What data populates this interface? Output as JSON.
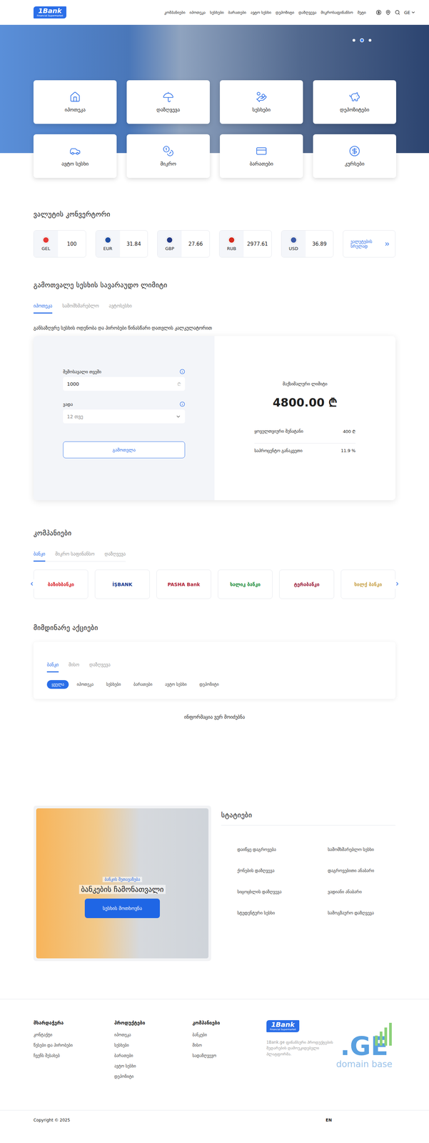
{
  "header": {
    "logo": {
      "title": "1Bank",
      "subtitle": "Financial Supermarket"
    },
    "nav": [
      "კომპანიები",
      "იპოთეკა",
      "სესხები",
      "ბარათები",
      "ავტო სესხი",
      "დეპოზიტი",
      "დაზღვევა",
      "მიკროსაფინანსო",
      "მეტი"
    ],
    "language": "GE"
  },
  "hero": {
    "slides": [
      {
        "selected": false
      },
      {
        "selected": true
      },
      {
        "selected": false
      }
    ]
  },
  "categories": [
    "იპოთეკა",
    "დაზღვევა",
    "სესხები",
    "დეპოზიტები",
    "ავტო სესხი",
    "მიკრო",
    "ბარათები",
    "კურსები"
  ],
  "converter": {
    "title": "ვალუტის კონვერტორი",
    "currencies": [
      {
        "code": "GEL",
        "amount": "100",
        "color": "#e53935"
      },
      {
        "code": "EUR",
        "amount": "31.84",
        "color": "#1f4ea3"
      },
      {
        "code": "GBP",
        "amount": "27.66",
        "color": "#233a86"
      },
      {
        "code": "RUB",
        "amount": "2977.61",
        "color": "#d52b1e"
      },
      {
        "code": "USD",
        "amount": "36.89",
        "color": "#3c5aa6"
      }
    ],
    "more": "ვალუტების სრულად"
  },
  "calculator": {
    "title": "გამოთვალე სესხის სავარაუდო ლიმიტი",
    "tabs": [
      {
        "label": "იპოთეკა",
        "selected": true
      },
      {
        "label": "სამომხმარებლო",
        "selected": false
      },
      {
        "label": "ავტოსესხი",
        "selected": false
      }
    ],
    "description": "განსაზღვრე სესხის ოდენობა და პირობები წინასწარი დათვლის კალკულატორით",
    "income": {
      "label": "შემოსავალი თვეში",
      "value": "1000",
      "unit": "₾"
    },
    "term": {
      "label": "ვადა",
      "value": "12 თვე"
    },
    "button": "გამოთვლა",
    "result": {
      "label": "მაქსიმალური ლიმიტი",
      "value": "4800.00 ₾",
      "rows": [
        {
          "label": "ყოველთვიური შენატანი",
          "value": "400 ₾"
        },
        {
          "label": "საპროცენტო განაკვეთი",
          "value": "11.9 %"
        }
      ]
    }
  },
  "companies": {
    "title": "კომპანიები",
    "tabs": [
      {
        "label": "ბანკი",
        "selected": true
      },
      {
        "label": "მიკრო საფინანსო",
        "selected": false
      },
      {
        "label": "დაზღვევა",
        "selected": false
      }
    ],
    "prev": "‹",
    "next": "›",
    "logos": [
      {
        "name": "ბაზისბანკი",
        "color": "#d9272e"
      },
      {
        "name": "İŞBANK",
        "color": "#1a3a8f"
      },
      {
        "name": "PASHA Bank",
        "color": "#b0263a"
      },
      {
        "name": "ხალიკ ბანკი",
        "color": "#1a8c3a"
      },
      {
        "name": "ტერაბანკი",
        "color": "#9b1b3a"
      },
      {
        "name": "სილქ ბანკი",
        "color": "#c8a34a"
      }
    ]
  },
  "actions": {
    "title": "მიმდინარე აქციები",
    "tabs": [
      {
        "label": "ბანკი",
        "selected": true
      },
      {
        "label": "მისო",
        "selected": false
      },
      {
        "label": "დაზღვევა",
        "selected": false
      }
    ],
    "filters": [
      {
        "label": "ყველა",
        "selected": true
      },
      {
        "label": "იპოთეკა",
        "selected": false
      },
      {
        "label": "სესხები",
        "selected": false
      },
      {
        "label": "ბარათები",
        "selected": false
      },
      {
        "label": "ავტო სესხი",
        "selected": false
      },
      {
        "label": "დეპოზიტი",
        "selected": false
      }
    ],
    "empty": "ინფორმაცია ვერ მოიძებნა"
  },
  "promo": {
    "label": "ბანკის შეთავაზება",
    "title": "ბანკების ჩამონათვალი",
    "button": "სესხის მოთხოვნა"
  },
  "articles": {
    "title": "სტატიები",
    "items": [
      "დაიწყე დაგროვება",
      "სამომხმარებლო სესხი",
      "ქონების დაზღვევა",
      "დაგროვებითი ანაბარი",
      "სიცოცხლის დაზღვევა",
      "ვადიანი ანაბარი",
      "სტუდენტური სესხი",
      "სამოგზაურო დაზღვევა"
    ]
  },
  "footer": {
    "columns": [
      {
        "title": "მხარდაჭერა",
        "links": [
          "კონტაქტი",
          "წესები და პირობები",
          "ჩვენს შესახებ"
        ]
      },
      {
        "title": "პროდუქტები",
        "links": [
          "იპოთეკა",
          "სესხები",
          "ბარათები",
          "ავტო სესხი",
          "დეპოზიტი"
        ]
      },
      {
        "title": "კომპანიები",
        "links": [
          "ბანკები",
          "მისო",
          "სადაზღვევო"
        ]
      }
    ],
    "description": "1Bank.ge ფინანსური პროდუქტების შედარების დამოუკიდებელი პლატფორმა.",
    "watermark": {
      "title": ".GE",
      "subtitle": "domain base"
    },
    "copyright": "Copyright © 2025",
    "language": "EN"
  }
}
